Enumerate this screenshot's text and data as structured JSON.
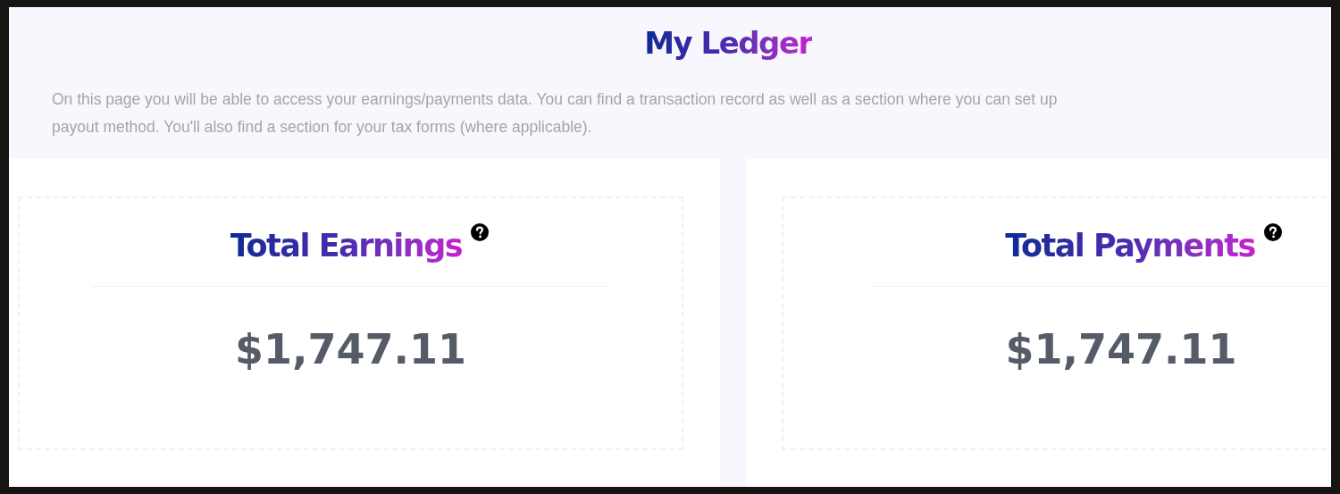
{
  "header": {
    "title": "My Ledger",
    "description": [
      "On this page you will be able to access your earnings/payments data. You can find a transaction record as well as a section where you can set up",
      "payout method. You'll also find a section for your tax forms (where applicable)."
    ]
  },
  "cards": [
    {
      "title": "Total Earnings",
      "amount": "$1,747.11"
    },
    {
      "title": "Total Payments",
      "amount": "$1,747.11"
    }
  ]
}
